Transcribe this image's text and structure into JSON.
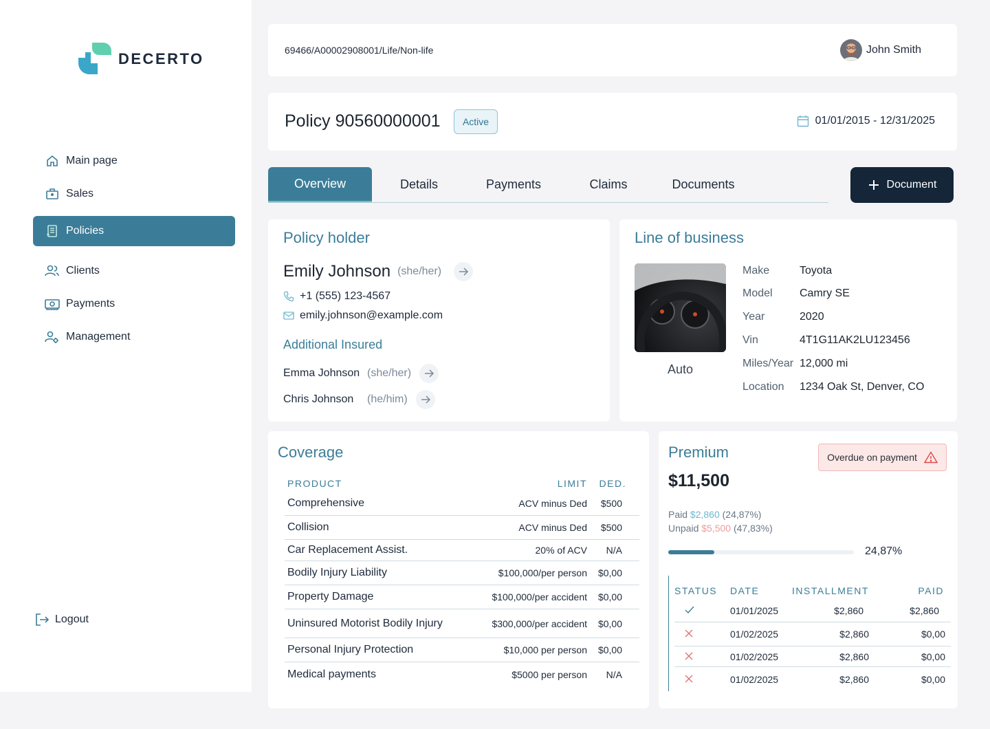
{
  "brand": {
    "name": "DECERTO",
    "logo_color_1": "#5fcfb0",
    "logo_color_2": "#3aa7c9"
  },
  "sidebar": {
    "items": [
      {
        "label": "Main page",
        "icon": "home-icon"
      },
      {
        "label": "Sales",
        "icon": "briefcase-icon"
      },
      {
        "label": "Policies",
        "icon": "document-icon",
        "active": true
      },
      {
        "label": "Clients",
        "icon": "users-icon"
      },
      {
        "label": "Payments",
        "icon": "cash-icon"
      },
      {
        "label": "Management",
        "icon": "user-gear-icon"
      }
    ],
    "logout_label": "Logout"
  },
  "topbar": {
    "breadcrumb": "69466/A00002908001/Life/Non-life",
    "user_name": "John Smith"
  },
  "policy": {
    "title": "Policy 90560000001",
    "status": "Active",
    "date_range": "01/01/2015 - 12/31/2025"
  },
  "tabs": [
    {
      "label": "Overview",
      "active": true
    },
    {
      "label": "Details"
    },
    {
      "label": "Payments"
    },
    {
      "label": "Claims"
    },
    {
      "label": "Documents"
    }
  ],
  "document_button": "Document",
  "holder": {
    "section_title": "Policy holder",
    "name": "Emily Johnson",
    "pronoun": "(she/her)",
    "phone": "+1 (555) 123-4567",
    "email": "emily.johnson@example.com",
    "additional_title": "Additional Insured",
    "additional": [
      {
        "name": "Emma Johnson",
        "pronoun": "(she/her)"
      },
      {
        "name": "Chris Johnson",
        "pronoun": "(he/him)"
      }
    ]
  },
  "lob": {
    "section_title": "Line of business",
    "image_label": "Auto",
    "fields": [
      {
        "key": "Make",
        "value": "Toyota"
      },
      {
        "key": "Model",
        "value": "Camry SE"
      },
      {
        "key": "Year",
        "value": "2020"
      },
      {
        "key": "Vin",
        "value": "4T1G11AK2LU123456"
      },
      {
        "key": "Miles/Year",
        "value": "12,000 mi"
      },
      {
        "key": "Location",
        "value": "1234 Oak St, Denver, CO"
      }
    ]
  },
  "coverage": {
    "section_title": "Coverage",
    "headers": {
      "product": "PRODUCT",
      "limit": "LIMIT",
      "ded": "DED."
    },
    "rows": [
      {
        "product": "Comprehensive",
        "limit": "ACV minus Ded",
        "ded": "$500"
      },
      {
        "product": "Collision",
        "limit": "ACV minus Ded",
        "ded": "$500"
      },
      {
        "product": "Car Replacement Assist.",
        "limit": "20% of ACV",
        "ded": "N/A"
      },
      {
        "product": "Bodily Injury Liability",
        "limit": "$100,000/per person",
        "ded": "$0,00"
      },
      {
        "product": "Property Damage",
        "limit": "$100,000/per accident",
        "ded": "$0,00"
      },
      {
        "product": "Uninsured Motorist Bodily Injury",
        "limit": "$300,000/per accident",
        "ded": "$0,00"
      },
      {
        "product": "Personal Injury Protection",
        "limit": "$10,000 per person",
        "ded": "$0,00"
      },
      {
        "product": "Medical payments",
        "limit": "$5000 per person",
        "ded": "N/A"
      }
    ]
  },
  "premium": {
    "section_title": "Premium",
    "amount": "$11,500",
    "overdue_label": "Overdue on payment",
    "paid_label": "Paid",
    "paid_amount": "$2,860",
    "paid_pct": "(24,87%)",
    "unpaid_label": "Unpaid",
    "unpaid_amount": "$5,500",
    "unpaid_pct": "(47,83%)",
    "progress_value": 24.87,
    "progress_label": "24,87%",
    "paid_color": "#6fb6cf",
    "unpaid_color": "#f29a9a",
    "headers": {
      "status": "STATUS",
      "date": "DATE",
      "installment": "INSTALLMENT",
      "paid": "PAID"
    },
    "rows": [
      {
        "status": "paid",
        "icon": "check-icon",
        "date": "01/01/2025",
        "installment": "$2,860",
        "paid": "$2,860"
      },
      {
        "status": "unpaid",
        "icon": "x-icon",
        "date": "01/02/2025",
        "installment": "$2,860",
        "paid": "$0,00"
      },
      {
        "status": "unpaid",
        "icon": "x-icon",
        "date": "01/02/2025",
        "installment": "$2,860",
        "paid": "$0,00"
      },
      {
        "status": "unpaid",
        "icon": "x-icon",
        "date": "01/02/2025",
        "installment": "$2,860",
        "paid": "$0,00"
      }
    ]
  }
}
